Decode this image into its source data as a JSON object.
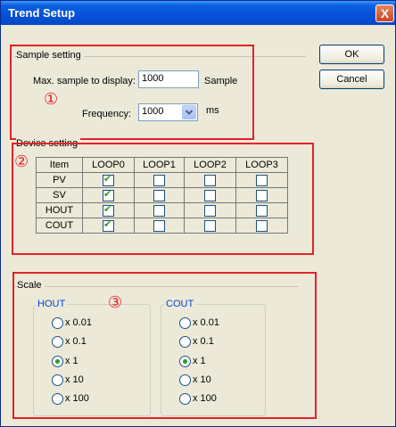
{
  "window": {
    "title": "Trend Setup",
    "close_glyph": "X"
  },
  "buttons": {
    "ok": "OK",
    "cancel": "Cancel"
  },
  "annotations": {
    "one": "①",
    "two": "②",
    "three": "③"
  },
  "sample_setting": {
    "label": "Sample setting",
    "max_label": "Max. sample to display:",
    "max_value": "1000",
    "max_unit": "Sample",
    "freq_label": "Frequency:",
    "freq_value": "1000",
    "freq_unit": "ms"
  },
  "device_setting": {
    "label": "Device setting",
    "columns": [
      "Item",
      "LOOP0",
      "LOOP1",
      "LOOP2",
      "LOOP3"
    ],
    "rows": [
      {
        "name": "PV",
        "checked": [
          true,
          false,
          false,
          false
        ]
      },
      {
        "name": "SV",
        "checked": [
          true,
          false,
          false,
          false
        ]
      },
      {
        "name": "HOUT",
        "checked": [
          true,
          false,
          false,
          false
        ]
      },
      {
        "name": "COUT",
        "checked": [
          true,
          false,
          false,
          false
        ]
      }
    ]
  },
  "scale": {
    "label": "Scale",
    "hout": {
      "label": "HOUT",
      "options": [
        "x 0.01",
        "x 0.1",
        "x 1",
        "x 10",
        "x 100"
      ],
      "selected": "x 1"
    },
    "cout": {
      "label": "COUT",
      "options": [
        "x 0.01",
        "x 0.1",
        "x 1",
        "x 10",
        "x 100"
      ],
      "selected": "x 1"
    }
  },
  "colors": {
    "accent_red": "#e1222a",
    "title_blue": "#0551d8",
    "check_green": "#21a121"
  }
}
